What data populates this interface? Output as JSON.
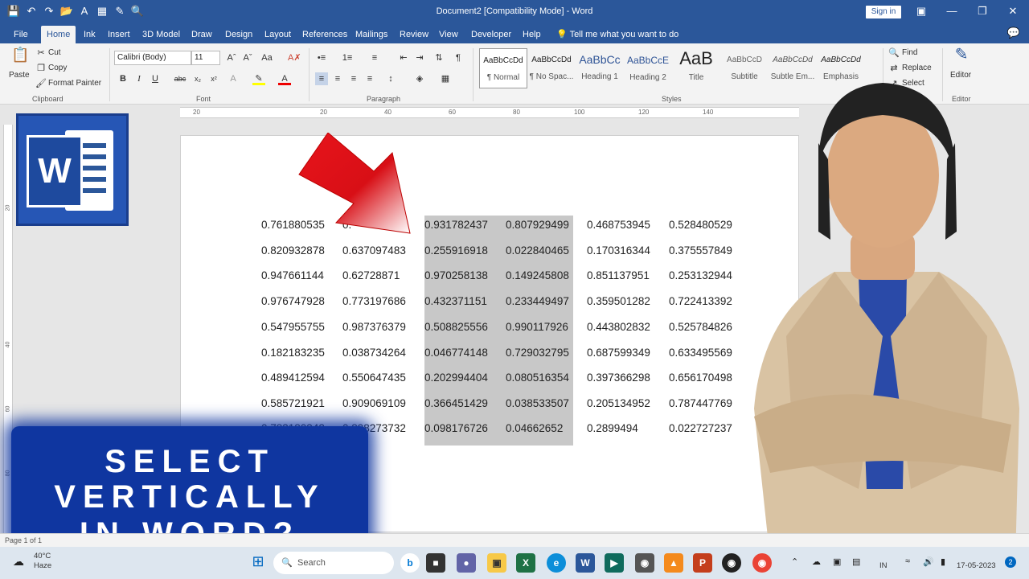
{
  "titlebar": {
    "doc_title": "Document2 [Compatibility Mode] - Word",
    "sign_in": "Sign in",
    "qat_icons": [
      "save-icon",
      "undo-icon",
      "redo-icon",
      "open-icon",
      "spelling-icon",
      "table-icon",
      "draw-icon",
      "print-preview-icon"
    ],
    "window_controls": [
      "ribbon-display-icon",
      "minimize-icon",
      "restore-icon",
      "close-icon"
    ]
  },
  "tabs": [
    "File",
    "Home",
    "Ink",
    "Insert",
    "3D Model",
    "Draw",
    "Design",
    "Layout",
    "References",
    "Mailings",
    "Review",
    "View",
    "Developer",
    "Help"
  ],
  "active_tab": "Home",
  "tell_me": "Tell me what you want to do",
  "ribbon": {
    "clipboard": {
      "paste": "Paste",
      "cut": "Cut",
      "copy": "Copy",
      "format_painter": "Format Painter",
      "label": "Clipboard"
    },
    "font": {
      "family": "Calibri (Body)",
      "size": "11",
      "label": "Font"
    },
    "paragraph": {
      "label": "Paragraph"
    },
    "styles": {
      "label": "Styles",
      "items": [
        {
          "sample": "AaBbCcDd",
          "name": "¶ Normal"
        },
        {
          "sample": "AaBbCcDd",
          "name": "¶ No Spac..."
        },
        {
          "sample": "AaBbCc",
          "name": "Heading 1"
        },
        {
          "sample": "AaBbCcE",
          "name": "Heading 2"
        },
        {
          "sample": "AaB",
          "name": "Title"
        },
        {
          "sample": "AaBbCcD",
          "name": "Subtitle"
        },
        {
          "sample": "AaBbCcDd",
          "name": "Subtle Em..."
        },
        {
          "sample": "AaBbCcDd",
          "name": "Emphasis"
        }
      ]
    },
    "editing": {
      "find": "Find",
      "replace": "Replace",
      "select": "Select"
    },
    "editor": {
      "label": "Editor",
      "button": "Editor"
    }
  },
  "ruler_ticks": [
    "20",
    "20",
    "40",
    "60",
    "80",
    "100",
    "120",
    "140"
  ],
  "vruler_ticks": [
    "20",
    "40",
    "60",
    "80"
  ],
  "table": {
    "rows": [
      [
        "0.761880535",
        "0.",
        "0.931782437",
        "0.807929499",
        "0.468753945",
        "0.528480529"
      ],
      [
        "0.820932878",
        "0.637097483",
        "0.255916918",
        "0.022840465",
        "0.170316344",
        "0.375557849"
      ],
      [
        "0.947661144",
        "0.62728871",
        "0.970258138",
        "0.149245808",
        "0.851137951",
        "0.253132944"
      ],
      [
        "0.976747928",
        "0.773197686",
        "0.432371151",
        "0.233449497",
        "0.359501282",
        "0.722413392"
      ],
      [
        "0.547955755",
        "0.987376379",
        "0.508825556",
        "0.990117926",
        "0.443802832",
        "0.525784826"
      ],
      [
        "0.182183235",
        "0.038734264",
        "0.046774148",
        "0.729032795",
        "0.687599349",
        "0.633495569"
      ],
      [
        "0.489412594",
        "0.550647435",
        "0.202994404",
        "0.080516354",
        "0.397366298",
        "0.656170498"
      ],
      [
        "0.585721921",
        "0.909069109",
        "0.366451429",
        "0.038533507",
        "0.205134952",
        "0.787447769"
      ],
      [
        "0.783180342",
        "0.898273732",
        "0.098176726",
        "0.04662652",
        "0.2899494",
        "0.022727237"
      ]
    ]
  },
  "status": {
    "page": "Page 1 of 1"
  },
  "taskbar": {
    "weather_temp": "40°C",
    "weather_desc": "Haze",
    "search": "Search",
    "lang": "IN",
    "date": "17-05-2023",
    "notif_count": "2"
  },
  "overlay": {
    "line1": "SELECT",
    "line2": "VERTICALLY",
    "line3": "IN WORD?"
  },
  "logo": {
    "letter": "W"
  },
  "colors": {
    "word_blue": "#2b579a",
    "banner": "#0f36a0",
    "selection": "#c8c8c8",
    "arrow_red": "#e8141b"
  }
}
